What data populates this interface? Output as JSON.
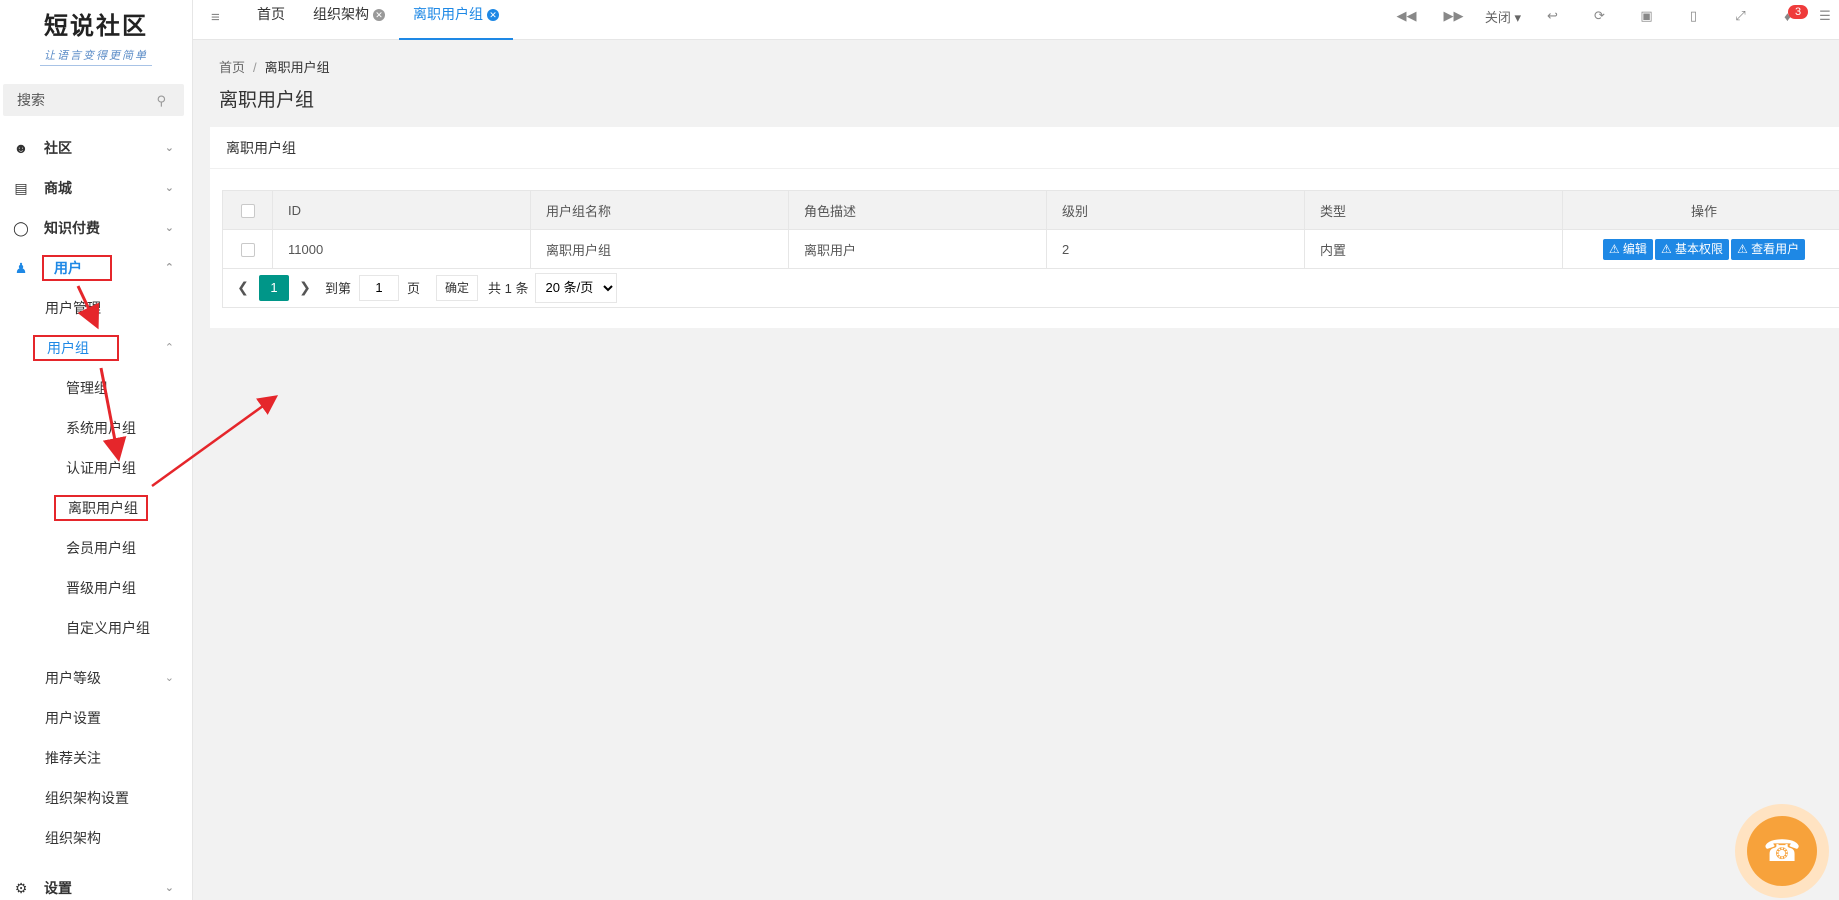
{
  "sidebar": {
    "logo_title": "短说社区",
    "logo_slogan": "让语言变得更简单",
    "search_placeholder": "搜索",
    "items": [
      {
        "label": "社区"
      },
      {
        "label": "商城"
      },
      {
        "label": "知识付费"
      },
      {
        "label": "用户"
      },
      {
        "label": "用户管理"
      },
      {
        "label": "用户组"
      },
      {
        "label": "管理组"
      },
      {
        "label": "系统用户组"
      },
      {
        "label": "认证用户组"
      },
      {
        "label": "离职用户组"
      },
      {
        "label": "会员用户组"
      },
      {
        "label": "晋级用户组"
      },
      {
        "label": "自定义用户组"
      },
      {
        "label": "用户等级"
      },
      {
        "label": "用户设置"
      },
      {
        "label": "推荐关注"
      },
      {
        "label": "组织架构设置"
      },
      {
        "label": "组织架构"
      },
      {
        "label": "设置"
      }
    ]
  },
  "header": {
    "tabs": [
      {
        "label": "首页"
      },
      {
        "label": "组织架构"
      },
      {
        "label": "离职用户组"
      }
    ],
    "close_label": "关闭",
    "notification_count": "3"
  },
  "content": {
    "breadcrumb": {
      "home": "首页",
      "current": "离职用户组"
    },
    "page_title": "离职用户组",
    "card_title": "离职用户组",
    "table": {
      "headers": [
        "ID",
        "用户组名称",
        "角色描述",
        "级别",
        "类型",
        "操作"
      ],
      "rows": [
        {
          "id": "11000",
          "name": "离职用户组",
          "desc": "离职用户",
          "level": "2",
          "type": "内置"
        }
      ],
      "actions": [
        "编辑",
        "基本权限",
        "查看用户"
      ]
    },
    "pager": {
      "current": "1",
      "goto_label": "到第",
      "goto_value": "1",
      "page_suffix": "页",
      "confirm": "确定",
      "total": "共 1 条",
      "page_size": "20 条/页"
    }
  },
  "colors": {
    "primary": "#1e88e5",
    "pager_active": "#009688",
    "annotation": "#e5262b",
    "badge": "#ef3b3b"
  }
}
